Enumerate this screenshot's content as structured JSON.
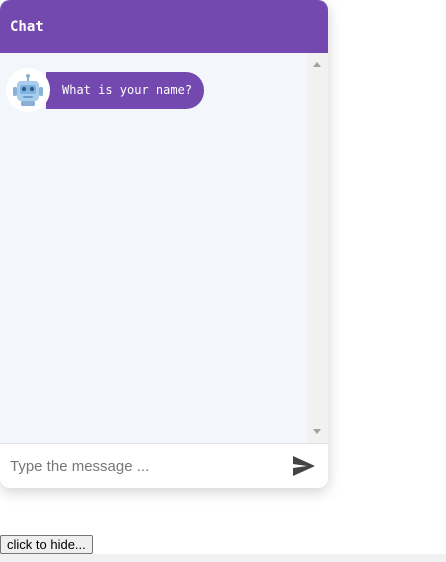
{
  "chat": {
    "title": "Chat",
    "messages": [
      {
        "sender": "bot",
        "avatar_icon": "robot-icon",
        "text": "What is your name?"
      }
    ],
    "input": {
      "placeholder": "Type the message ...",
      "value": ""
    },
    "send_icon": "send-icon"
  },
  "page": {
    "hide_button_label": "click to hide..."
  },
  "colors": {
    "accent": "#7449af",
    "chat_background": "#f3f7fb"
  }
}
